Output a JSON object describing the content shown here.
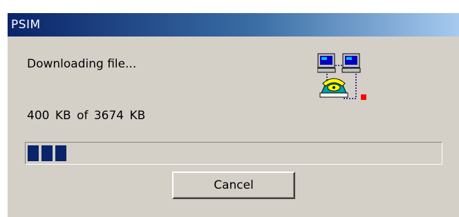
{
  "window": {
    "title": "PSIM"
  },
  "dialog": {
    "status_text": "Downloading file...",
    "size_text": "400 KB  of  3674 KB",
    "icon": "network-transfer-icon",
    "progress": {
      "downloaded_kb": 400,
      "total_kb": 3674,
      "fraction": 0.109,
      "fill_color": "#0a246a"
    },
    "cancel_label": "Cancel"
  },
  "colors": {
    "titlebar_start": "#0a246a",
    "titlebar_end": "#a6caf0",
    "face": "#d4d0c8"
  }
}
